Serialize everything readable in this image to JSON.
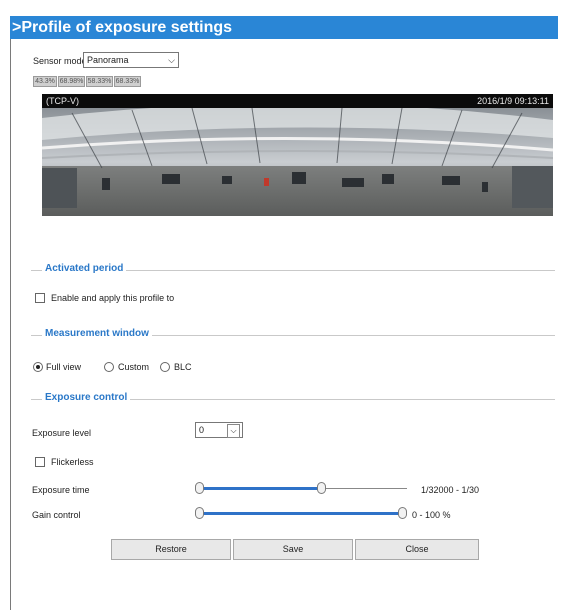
{
  "title": ">Profile of exposure settings",
  "sensor_mode": {
    "label": "Sensor mode",
    "value": "Panorama"
  },
  "zoom_buttons": [
    "43.3%",
    "68.98%",
    "58.33%",
    "68.33%"
  ],
  "video": {
    "protocol": "(TCP-V)",
    "timestamp": "2016/1/9 09:13:11"
  },
  "activated_period": {
    "legend": "Activated period",
    "checkbox_label": "Enable and apply this profile to",
    "checked": false
  },
  "measurement_window": {
    "legend": "Measurement window",
    "options": [
      "Full view",
      "Custom",
      "BLC"
    ],
    "selected": "Full view"
  },
  "exposure_control": {
    "legend": "Exposure control",
    "exposure_level": {
      "label": "Exposure level",
      "value": "0"
    },
    "flickerless": {
      "label": "Flickerless",
      "checked": false
    },
    "exposure_time": {
      "label": "Exposure time",
      "range_text": "1/32000 - 1/30",
      "position": 0.6
    },
    "gain_control": {
      "label": "Gain control",
      "range_text": "0 - 100 %",
      "position": 1.0
    }
  },
  "buttons": {
    "restore": "Restore",
    "save": "Save",
    "close": "Close"
  },
  "colors": {
    "accent": "#2a86d6",
    "legend": "#2a78c8",
    "slider": "#2f72c8"
  }
}
